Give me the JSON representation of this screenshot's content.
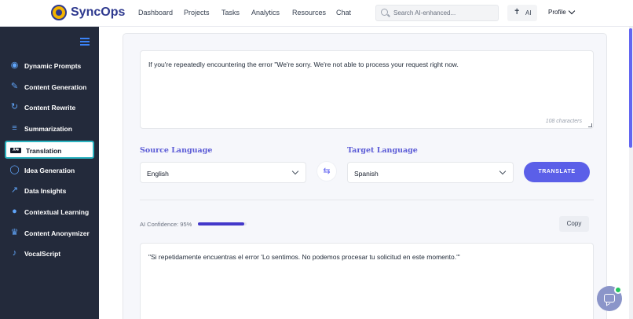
{
  "app": {
    "name": "SyncOps"
  },
  "nav": [
    "Dashboard",
    "Projects",
    "Tasks",
    "Analytics",
    "Resources",
    "Chat"
  ],
  "search": {
    "placeholder": "Search AI-enhanced..."
  },
  "ai_button": {
    "label": "AI"
  },
  "profile": {
    "label": "Profile"
  },
  "sidebar": {
    "items": [
      {
        "label": "Dynamic Prompts",
        "icon": "robot-icon"
      },
      {
        "label": "Content Generation",
        "icon": "pen-icon"
      },
      {
        "label": "Content Rewrite",
        "icon": "refresh-icon"
      },
      {
        "label": "Summarization",
        "icon": "text-align-icon"
      },
      {
        "label": "Translation",
        "icon": "translate-icon",
        "active": true
      },
      {
        "label": "Idea Generation",
        "icon": "lightbulb-icon"
      },
      {
        "label": "Data Insights",
        "icon": "chart-line-icon"
      },
      {
        "label": "Contextual Learning",
        "icon": "brain-icon"
      },
      {
        "label": "Content Anonymizer",
        "icon": "user-secret-icon"
      },
      {
        "label": "VocalScript",
        "icon": "microphone-icon"
      }
    ]
  },
  "translation": {
    "input_text": "If you're repeatedly encountering the error \"We're sorry. We're not able to process your request right now.",
    "char_count": "108 characters",
    "source_label": "Source Language",
    "source_value": "English",
    "target_label": "Target Language",
    "target_value": "Spanish",
    "translate_label": "TRANSLATE",
    "confidence_label": "AI Confidence: 95%",
    "confidence_value": 0.95,
    "copy_label": "Copy",
    "output_text": "\"Si repetidamente encuentras el error 'Lo sentimos. No podemos procesar tu solicitud en este momento.'\""
  },
  "colors": {
    "brand": "#2f3a8f",
    "accent": "#5b5fe8",
    "sidebar_bg": "#232a3b",
    "active_border": "#2bb3c0",
    "online": "#22c55e"
  }
}
